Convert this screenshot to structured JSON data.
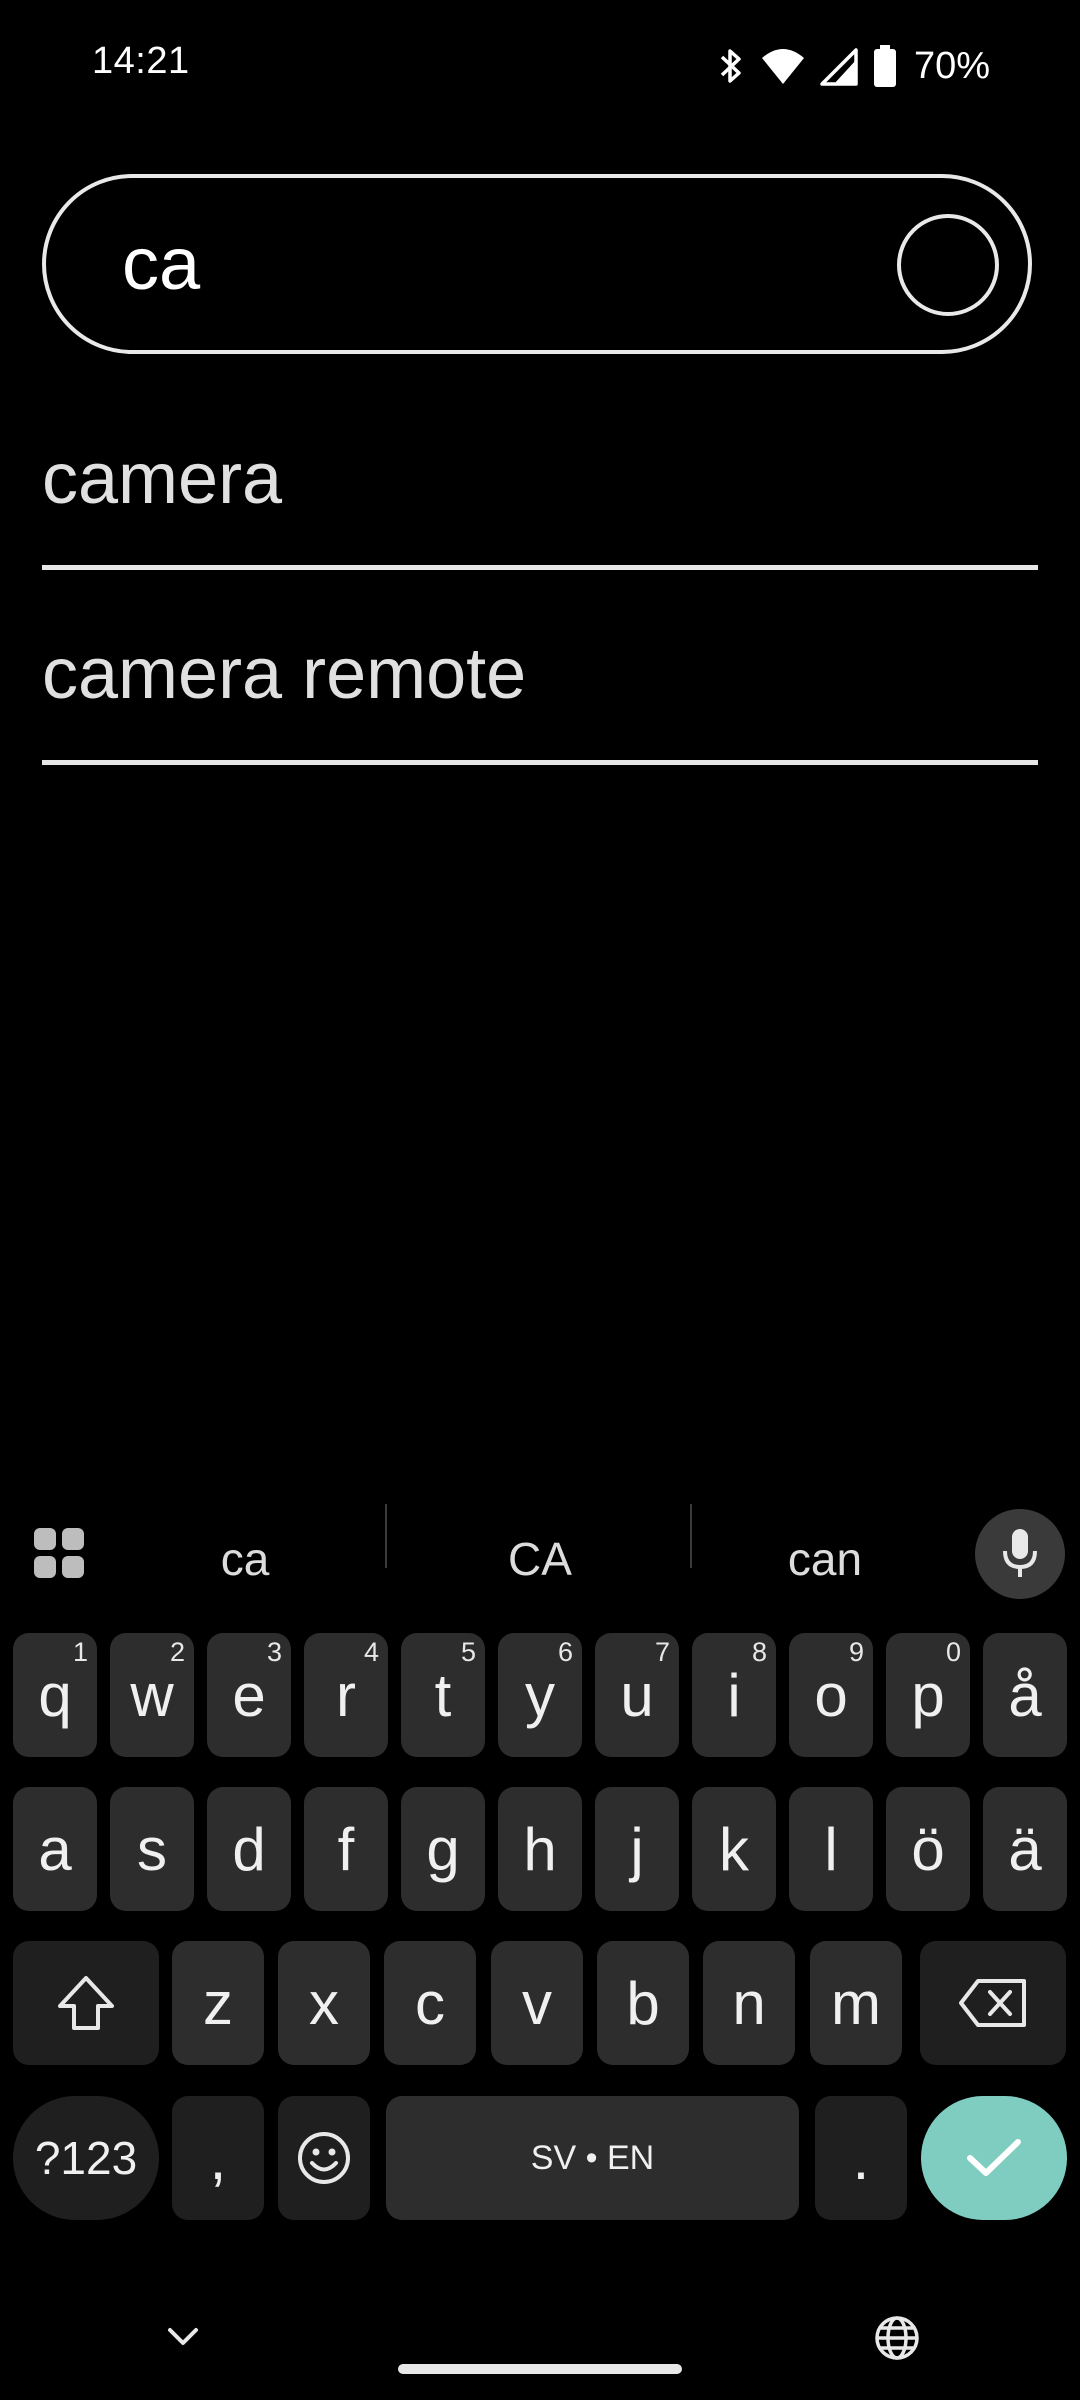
{
  "status_bar": {
    "time": "14:21",
    "battery": "70%"
  },
  "search": {
    "query": "ca"
  },
  "results": [
    {
      "label": "camera"
    },
    {
      "label": "camera remote"
    }
  ],
  "keyboard": {
    "suggestions": [
      "ca",
      "CA",
      "can"
    ],
    "row1": [
      {
        "key": "q",
        "hint": "1"
      },
      {
        "key": "w",
        "hint": "2"
      },
      {
        "key": "e",
        "hint": "3"
      },
      {
        "key": "r",
        "hint": "4"
      },
      {
        "key": "t",
        "hint": "5"
      },
      {
        "key": "y",
        "hint": "6"
      },
      {
        "key": "u",
        "hint": "7"
      },
      {
        "key": "i",
        "hint": "8"
      },
      {
        "key": "o",
        "hint": "9"
      },
      {
        "key": "p",
        "hint": "0"
      },
      {
        "key": "å",
        "hint": ""
      }
    ],
    "row2": [
      "a",
      "s",
      "d",
      "f",
      "g",
      "h",
      "j",
      "k",
      "l",
      "ö",
      "ä"
    ],
    "row3": [
      "z",
      "x",
      "c",
      "v",
      "b",
      "n",
      "m"
    ],
    "symbols_label": "?123",
    "comma": ",",
    "space_label": "SV • EN",
    "period": ".",
    "accent_color": "#7fcdc0"
  },
  "icons": {
    "apps": "grid-icon",
    "mic": "mic-icon",
    "shift": "shift-icon",
    "backspace": "backspace-icon",
    "emoji": "emoji-icon",
    "enter": "check-icon",
    "hide": "chevron-down-icon",
    "language": "globe-icon"
  }
}
